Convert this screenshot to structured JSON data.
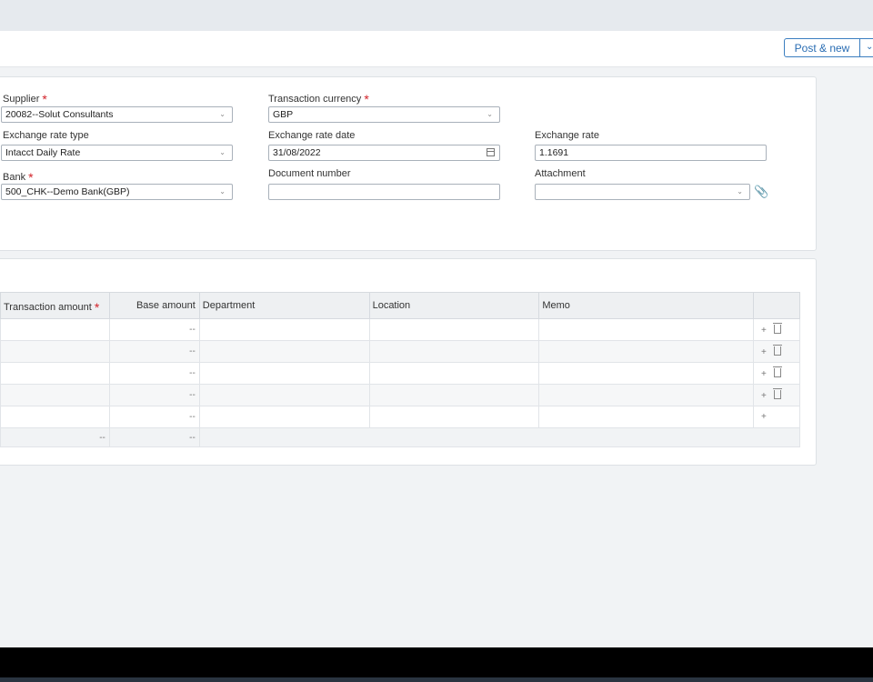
{
  "toolbar": {
    "post_new_label": "Post & new"
  },
  "header_form": {
    "supplier": {
      "label": "Supplier",
      "value": "20082--Solut Consultants"
    },
    "transaction_currency": {
      "label": "Transaction currency",
      "value": "GBP"
    },
    "exchange_rate_type": {
      "label": "Exchange rate type",
      "value": "Intacct Daily Rate"
    },
    "exchange_rate_date": {
      "label": "Exchange rate date",
      "value": "31/08/2022"
    },
    "exchange_rate": {
      "label": "Exchange rate",
      "value": "1.1691"
    },
    "bank": {
      "label": "Bank",
      "value": "500_CHK--Demo Bank(GBP)"
    },
    "document_number": {
      "label": "Document number",
      "value": ""
    },
    "attachment": {
      "label": "Attachment",
      "value": ""
    },
    "required_mark": "*"
  },
  "lines": {
    "columns": [
      "Transaction amount",
      "Base amount",
      "Department",
      "Location",
      "Memo"
    ],
    "rows": [
      {
        "transaction_amount": "",
        "base_amount": "--",
        "department": "",
        "location": "",
        "memo": ""
      },
      {
        "transaction_amount": "",
        "base_amount": "--",
        "department": "",
        "location": "",
        "memo": ""
      },
      {
        "transaction_amount": "",
        "base_amount": "--",
        "department": "",
        "location": "",
        "memo": ""
      },
      {
        "transaction_amount": "",
        "base_amount": "--",
        "department": "",
        "location": "",
        "memo": ""
      },
      {
        "transaction_amount": "",
        "base_amount": "--",
        "department": "",
        "location": "",
        "memo": ""
      }
    ],
    "totals": {
      "transaction_amount": "--",
      "base_amount": "--"
    }
  },
  "icons": {
    "add": "+",
    "delete": "trash-icon",
    "dropdown": "chevron-down-icon",
    "calendar": "calendar-icon",
    "attachment": "paperclip-icon"
  },
  "colors": {
    "accent": "#2a6db3",
    "required": "#d2232a"
  }
}
